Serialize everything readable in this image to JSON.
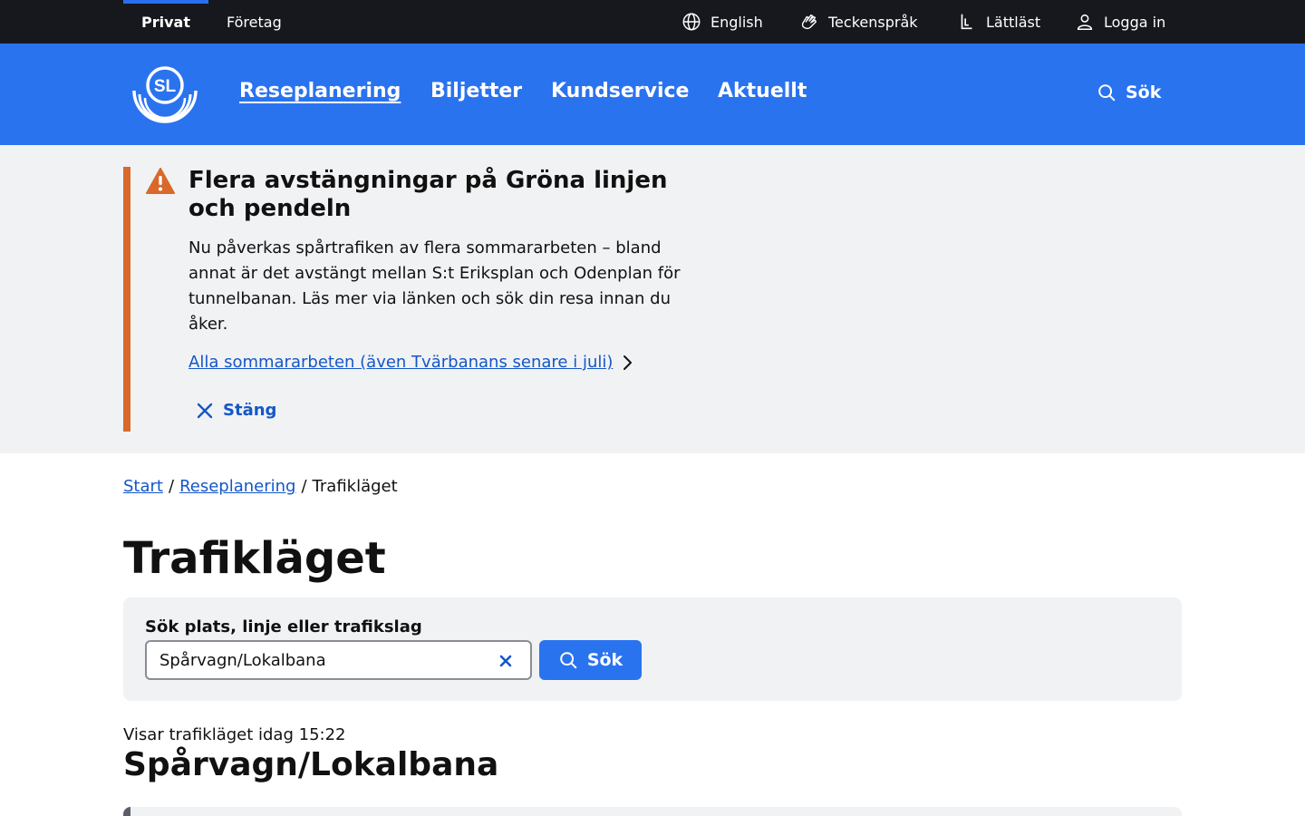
{
  "topbar": {
    "segments": [
      "Privat",
      "Företag"
    ],
    "utilities": {
      "english": "English",
      "teckensprak": "Teckenspråk",
      "lattlast": "Lättläst",
      "login": "Logga in"
    }
  },
  "mainnav": {
    "logo_text": "SL",
    "links": [
      "Reseplanering",
      "Biljetter",
      "Kundservice",
      "Aktuellt"
    ],
    "active": "Reseplanering",
    "search_label": "Sök"
  },
  "alert": {
    "title": "Flera avstängningar på Gröna linjen och pendeln",
    "body": "Nu påverkas spårtrafiken av flera sommararbeten – bland annat är det avstängt mellan S:t Eriksplan och Odenplan för tunnelbanan. Läs mer via länken och sök din resa innan du åker.",
    "link": "Alla sommararbeten (även Tvärbanans senare i juli)",
    "close_label": "Stäng"
  },
  "breadcrumb": {
    "items": [
      "Start",
      "Reseplanering",
      "Trafikläget"
    ],
    "separator": "/"
  },
  "page_title": "Trafikläget",
  "search": {
    "label": "Sök plats, linje eller trafikslag",
    "value": "Spårvagn/Lokalbana",
    "button_label": "Sök"
  },
  "status": {
    "showing": "Visar trafikläget idag 15:22",
    "result_title": "Spårvagn/Lokalbana"
  },
  "colors": {
    "topbar_bg": "#16181d",
    "brand_blue": "#2a73ef",
    "link_blue": "#1457c8",
    "alert_accent": "#d9692b",
    "panel_bg": "#f1f2f4"
  }
}
